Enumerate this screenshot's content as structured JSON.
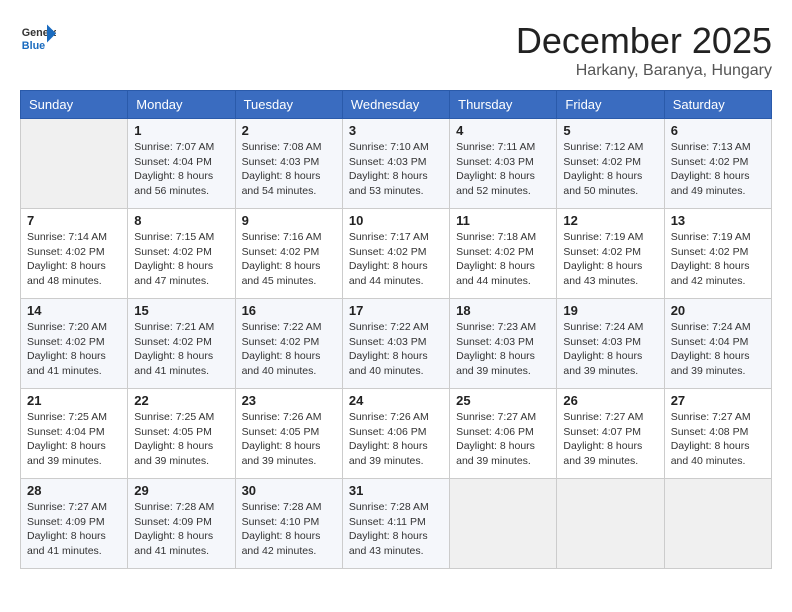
{
  "logo": {
    "general": "General",
    "blue": "Blue"
  },
  "header": {
    "month": "December 2025",
    "location": "Harkany, Baranya, Hungary"
  },
  "weekdays": [
    "Sunday",
    "Monday",
    "Tuesday",
    "Wednesday",
    "Thursday",
    "Friday",
    "Saturday"
  ],
  "weeks": [
    [
      {
        "day": "",
        "sunrise": "",
        "sunset": "",
        "daylight": ""
      },
      {
        "day": "1",
        "sunrise": "Sunrise: 7:07 AM",
        "sunset": "Sunset: 4:04 PM",
        "daylight": "Daylight: 8 hours and 56 minutes."
      },
      {
        "day": "2",
        "sunrise": "Sunrise: 7:08 AM",
        "sunset": "Sunset: 4:03 PM",
        "daylight": "Daylight: 8 hours and 54 minutes."
      },
      {
        "day": "3",
        "sunrise": "Sunrise: 7:10 AM",
        "sunset": "Sunset: 4:03 PM",
        "daylight": "Daylight: 8 hours and 53 minutes."
      },
      {
        "day": "4",
        "sunrise": "Sunrise: 7:11 AM",
        "sunset": "Sunset: 4:03 PM",
        "daylight": "Daylight: 8 hours and 52 minutes."
      },
      {
        "day": "5",
        "sunrise": "Sunrise: 7:12 AM",
        "sunset": "Sunset: 4:02 PM",
        "daylight": "Daylight: 8 hours and 50 minutes."
      },
      {
        "day": "6",
        "sunrise": "Sunrise: 7:13 AM",
        "sunset": "Sunset: 4:02 PM",
        "daylight": "Daylight: 8 hours and 49 minutes."
      }
    ],
    [
      {
        "day": "7",
        "sunrise": "Sunrise: 7:14 AM",
        "sunset": "Sunset: 4:02 PM",
        "daylight": "Daylight: 8 hours and 48 minutes."
      },
      {
        "day": "8",
        "sunrise": "Sunrise: 7:15 AM",
        "sunset": "Sunset: 4:02 PM",
        "daylight": "Daylight: 8 hours and 47 minutes."
      },
      {
        "day": "9",
        "sunrise": "Sunrise: 7:16 AM",
        "sunset": "Sunset: 4:02 PM",
        "daylight": "Daylight: 8 hours and 45 minutes."
      },
      {
        "day": "10",
        "sunrise": "Sunrise: 7:17 AM",
        "sunset": "Sunset: 4:02 PM",
        "daylight": "Daylight: 8 hours and 44 minutes."
      },
      {
        "day": "11",
        "sunrise": "Sunrise: 7:18 AM",
        "sunset": "Sunset: 4:02 PM",
        "daylight": "Daylight: 8 hours and 44 minutes."
      },
      {
        "day": "12",
        "sunrise": "Sunrise: 7:19 AM",
        "sunset": "Sunset: 4:02 PM",
        "daylight": "Daylight: 8 hours and 43 minutes."
      },
      {
        "day": "13",
        "sunrise": "Sunrise: 7:19 AM",
        "sunset": "Sunset: 4:02 PM",
        "daylight": "Daylight: 8 hours and 42 minutes."
      }
    ],
    [
      {
        "day": "14",
        "sunrise": "Sunrise: 7:20 AM",
        "sunset": "Sunset: 4:02 PM",
        "daylight": "Daylight: 8 hours and 41 minutes."
      },
      {
        "day": "15",
        "sunrise": "Sunrise: 7:21 AM",
        "sunset": "Sunset: 4:02 PM",
        "daylight": "Daylight: 8 hours and 41 minutes."
      },
      {
        "day": "16",
        "sunrise": "Sunrise: 7:22 AM",
        "sunset": "Sunset: 4:02 PM",
        "daylight": "Daylight: 8 hours and 40 minutes."
      },
      {
        "day": "17",
        "sunrise": "Sunrise: 7:22 AM",
        "sunset": "Sunset: 4:03 PM",
        "daylight": "Daylight: 8 hours and 40 minutes."
      },
      {
        "day": "18",
        "sunrise": "Sunrise: 7:23 AM",
        "sunset": "Sunset: 4:03 PM",
        "daylight": "Daylight: 8 hours and 39 minutes."
      },
      {
        "day": "19",
        "sunrise": "Sunrise: 7:24 AM",
        "sunset": "Sunset: 4:03 PM",
        "daylight": "Daylight: 8 hours and 39 minutes."
      },
      {
        "day": "20",
        "sunrise": "Sunrise: 7:24 AM",
        "sunset": "Sunset: 4:04 PM",
        "daylight": "Daylight: 8 hours and 39 minutes."
      }
    ],
    [
      {
        "day": "21",
        "sunrise": "Sunrise: 7:25 AM",
        "sunset": "Sunset: 4:04 PM",
        "daylight": "Daylight: 8 hours and 39 minutes."
      },
      {
        "day": "22",
        "sunrise": "Sunrise: 7:25 AM",
        "sunset": "Sunset: 4:05 PM",
        "daylight": "Daylight: 8 hours and 39 minutes."
      },
      {
        "day": "23",
        "sunrise": "Sunrise: 7:26 AM",
        "sunset": "Sunset: 4:05 PM",
        "daylight": "Daylight: 8 hours and 39 minutes."
      },
      {
        "day": "24",
        "sunrise": "Sunrise: 7:26 AM",
        "sunset": "Sunset: 4:06 PM",
        "daylight": "Daylight: 8 hours and 39 minutes."
      },
      {
        "day": "25",
        "sunrise": "Sunrise: 7:27 AM",
        "sunset": "Sunset: 4:06 PM",
        "daylight": "Daylight: 8 hours and 39 minutes."
      },
      {
        "day": "26",
        "sunrise": "Sunrise: 7:27 AM",
        "sunset": "Sunset: 4:07 PM",
        "daylight": "Daylight: 8 hours and 39 minutes."
      },
      {
        "day": "27",
        "sunrise": "Sunrise: 7:27 AM",
        "sunset": "Sunset: 4:08 PM",
        "daylight": "Daylight: 8 hours and 40 minutes."
      }
    ],
    [
      {
        "day": "28",
        "sunrise": "Sunrise: 7:27 AM",
        "sunset": "Sunset: 4:09 PM",
        "daylight": "Daylight: 8 hours and 41 minutes."
      },
      {
        "day": "29",
        "sunrise": "Sunrise: 7:28 AM",
        "sunset": "Sunset: 4:09 PM",
        "daylight": "Daylight: 8 hours and 41 minutes."
      },
      {
        "day": "30",
        "sunrise": "Sunrise: 7:28 AM",
        "sunset": "Sunset: 4:10 PM",
        "daylight": "Daylight: 8 hours and 42 minutes."
      },
      {
        "day": "31",
        "sunrise": "Sunrise: 7:28 AM",
        "sunset": "Sunset: 4:11 PM",
        "daylight": "Daylight: 8 hours and 43 minutes."
      },
      {
        "day": "",
        "sunrise": "",
        "sunset": "",
        "daylight": ""
      },
      {
        "day": "",
        "sunrise": "",
        "sunset": "",
        "daylight": ""
      },
      {
        "day": "",
        "sunrise": "",
        "sunset": "",
        "daylight": ""
      }
    ]
  ]
}
